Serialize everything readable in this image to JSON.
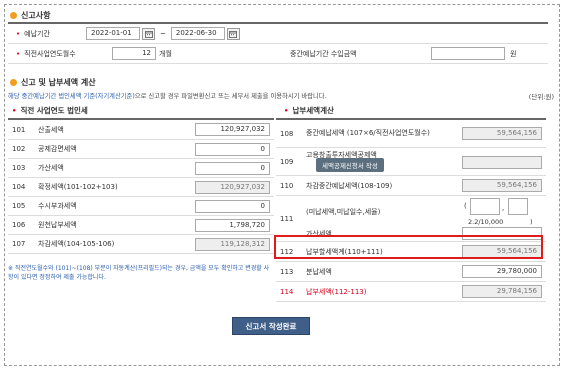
{
  "report_section": {
    "title": "신고사항",
    "period": {
      "label": "예납기간",
      "from": "2022-01-01",
      "sep": "~",
      "to": "2022-06-30"
    },
    "months": {
      "label": "직전사업연도월수",
      "value": "12",
      "unit": "개월"
    },
    "interim_income": {
      "label": "중간예납기간 수입금액",
      "value": "",
      "unit": "원"
    }
  },
  "calc_section": {
    "title": "신고 및 납부세액 계산",
    "description_blue": "해당 중간예납기간 법인세액 기준(자기계산기준)",
    "description_rest": "으로 신고할 경우 파일변환신고 또는 세무서 제출을 이용하시기 바랍니다.",
    "unit": "(단위:원)"
  },
  "left_table": {
    "heading": "직전 사업연도 법인세",
    "rows": [
      {
        "code": "101",
        "name": "산출세액",
        "value": "120,927,032",
        "readonly": false
      },
      {
        "code": "102",
        "name": "공제감면세액",
        "value": "0",
        "readonly": false
      },
      {
        "code": "103",
        "name": "가산세액",
        "value": "0",
        "readonly": false
      },
      {
        "code": "104",
        "name": "확정세액(101-102+103)",
        "value": "120,927,032",
        "readonly": true
      },
      {
        "code": "105",
        "name": "수시부과세액",
        "value": "0",
        "readonly": false
      },
      {
        "code": "106",
        "name": "원천납부세액",
        "value": "1,798,720",
        "readonly": false
      },
      {
        "code": "107",
        "name": "차감세액(104-105-106)",
        "value": "119,128,312",
        "readonly": true
      }
    ],
    "note": "※ 직전연도월수와 (101)~(108) 부분이 자동계산(프리필드)되는 경우, 금액을 모두 확인하고 변경할 사항이 있다면 정정하여 제출 가능합니다."
  },
  "right_table": {
    "heading": "납부세액계산",
    "r108": {
      "code": "108",
      "name": "중간예납세액 (107×6/직전사업연도월수)",
      "value": "59,564,156"
    },
    "r109": {
      "code": "109",
      "name": "고용창출투자세액공제액",
      "button": "세액공제신청서 작성",
      "value": ""
    },
    "r110": {
      "code": "110",
      "name": "차감중간예납세액(108-109)",
      "value": "59,564,156"
    },
    "r111": {
      "code": "111",
      "sub_a": "(미납세액,미납일수,세율)",
      "open": "(",
      "close": ")",
      "rate": "2.2/10,000",
      "sub_b": "가산세액",
      "value": ""
    },
    "r112": {
      "code": "112",
      "name": "납부할세액계(110+111)",
      "value": "59,564,156"
    },
    "r113": {
      "code": "113",
      "name": "분납세액",
      "value": "29,780,000"
    },
    "r114": {
      "code": "114",
      "name": "납부세액(112-113)",
      "value": "29,784,156"
    }
  },
  "actions": {
    "submit_label": "신고서 작성완료"
  },
  "colors": {
    "accent_orange": "#f29d1f",
    "bullet_red": "#d6001c",
    "highlight_red": "#e01b1b",
    "button_blue": "#3f5f88",
    "link_blue": "#2a5db0"
  }
}
